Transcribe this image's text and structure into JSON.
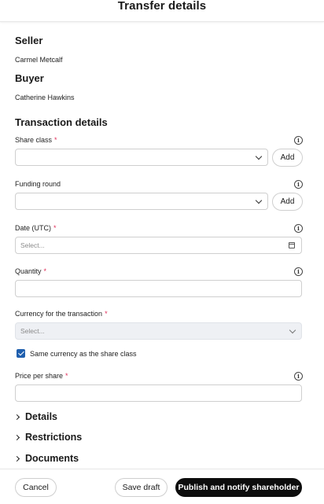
{
  "header": {
    "title": "Transfer details"
  },
  "seller": {
    "heading": "Seller",
    "name": "Carmel Metcalf"
  },
  "buyer": {
    "heading": "Buyer",
    "name": "Catherine Hawkins"
  },
  "transaction": {
    "heading": "Transaction details",
    "share_class": {
      "label": "Share class",
      "required": "*",
      "value": "",
      "add_label": "Add",
      "info_icon": "info-icon"
    },
    "funding_round": {
      "label": "Funding round",
      "value": "",
      "add_label": "Add",
      "info_icon": "info-icon"
    },
    "date": {
      "label": "Date (UTC)",
      "required": "*",
      "placeholder": "Select...",
      "icon": "calendar-icon"
    },
    "quantity": {
      "label": "Quantity",
      "required": "*",
      "value": ""
    },
    "currency": {
      "label": "Currency for the transaction",
      "required": "*",
      "placeholder": "Select...",
      "disabled": true
    },
    "same_currency": {
      "label": "Same currency as the share class",
      "checked": true
    },
    "price_per_share": {
      "label": "Price per share",
      "required": "*",
      "value": ""
    }
  },
  "sections": [
    {
      "label": "Details"
    },
    {
      "label": "Restrictions"
    },
    {
      "label": "Documents"
    }
  ],
  "footer": {
    "cancel_label": "Cancel",
    "save_draft_label": "Save draft",
    "publish_label": "Publish and notify shareholder"
  },
  "colors": {
    "primary_button": "#0d0d0d",
    "checkbox": "#1f5fae",
    "required": "#e0305a",
    "disabled_field": "#eef0f4"
  }
}
